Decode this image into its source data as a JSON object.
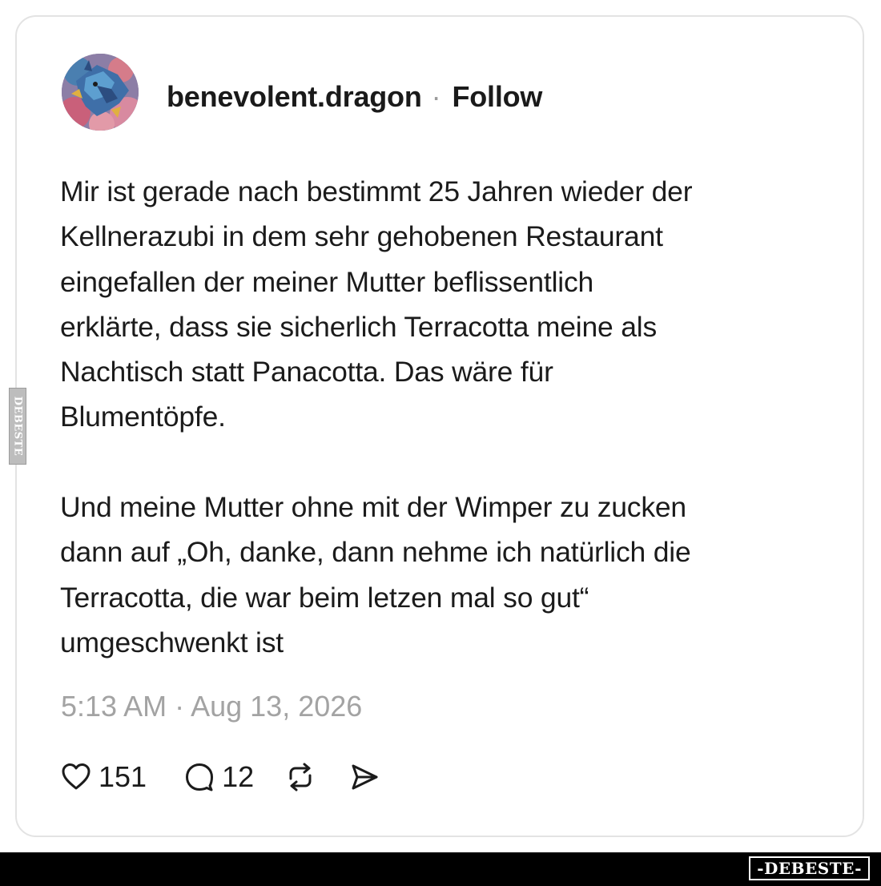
{
  "post": {
    "username": "benevolent.dragon",
    "separator": "·",
    "follow_label": "Follow",
    "text_lines": [
      "Mir ist gerade nach bestimmt 25 Jahren wieder der",
      "Kellnerazubi in dem sehr gehobenen Restaurant",
      "eingefallen der meiner Mutter beflissentlich",
      "erklärte, dass sie sicherlich Terracotta meine als",
      "Nachtisch statt Panacotta. Das wäre für",
      "Blumentöpfe.",
      "Und meine Mutter ohne mit der Wimper zu zucken",
      "dann auf „Oh, danke, dann nehme ich natürlich die",
      "Terracotta, die war beim letzen mal so gut“",
      "umgeschwenkt ist"
    ],
    "timestamp": "5:13 AM · Aug 13, 2026",
    "actions": {
      "like_icon": "heart-icon",
      "like_count": "151",
      "reply_icon": "comment-icon",
      "reply_count": "12",
      "repost_icon": "repost-icon",
      "share_icon": "send-icon"
    }
  },
  "watermark": {
    "side_text": "DEBESTE",
    "badge_text": "-DEBESTE-"
  },
  "colors": {
    "text": "#1b1b1b",
    "muted": "#a3a3a3",
    "card_border": "#e3e3e3",
    "bar": "#000000"
  }
}
